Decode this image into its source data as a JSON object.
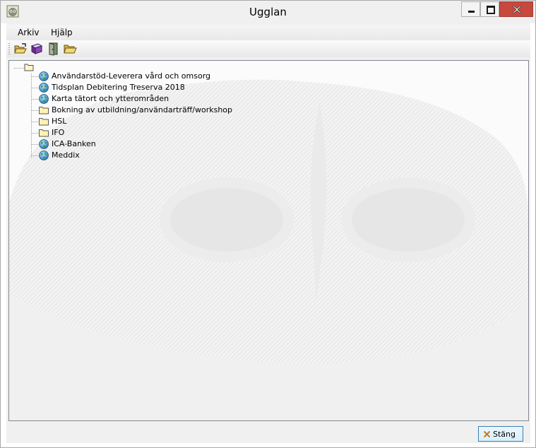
{
  "window": {
    "title": "Ugglan",
    "controls": [
      "minimize-icon",
      "maximize-icon",
      "close-icon"
    ]
  },
  "menu": {
    "items": [
      {
        "label": "Arkiv"
      },
      {
        "label": "Hjälp"
      }
    ]
  },
  "toolbar": {
    "buttons": [
      {
        "icon": "open-folder-icon"
      },
      {
        "icon": "book-icon"
      },
      {
        "icon": "exit-door-icon"
      },
      {
        "icon": "folder-open-icon"
      }
    ]
  },
  "tree": {
    "root_icon": "folder-icon",
    "items": [
      {
        "label": "Användarstöd-Leverera vård och omsorg",
        "icon": "globe-icon"
      },
      {
        "label": "Tidsplan Debitering Treserva 2018",
        "icon": "globe-icon"
      },
      {
        "label": "Karta tätort och ytterområden",
        "icon": "globe-icon"
      },
      {
        "label": "Bokning av utbildning/användarträff/workshop",
        "icon": "folder-icon"
      },
      {
        "label": "HSL",
        "icon": "folder-icon"
      },
      {
        "label": "IFO",
        "icon": "folder-icon"
      },
      {
        "label": "ICA-Banken",
        "icon": "globe-icon"
      },
      {
        "label": "Meddix",
        "icon": "globe-icon"
      }
    ]
  },
  "footer": {
    "close_label": "Stäng"
  },
  "colors": {
    "close_accent": "#c7483d",
    "button_border": "#3c7fb1"
  }
}
